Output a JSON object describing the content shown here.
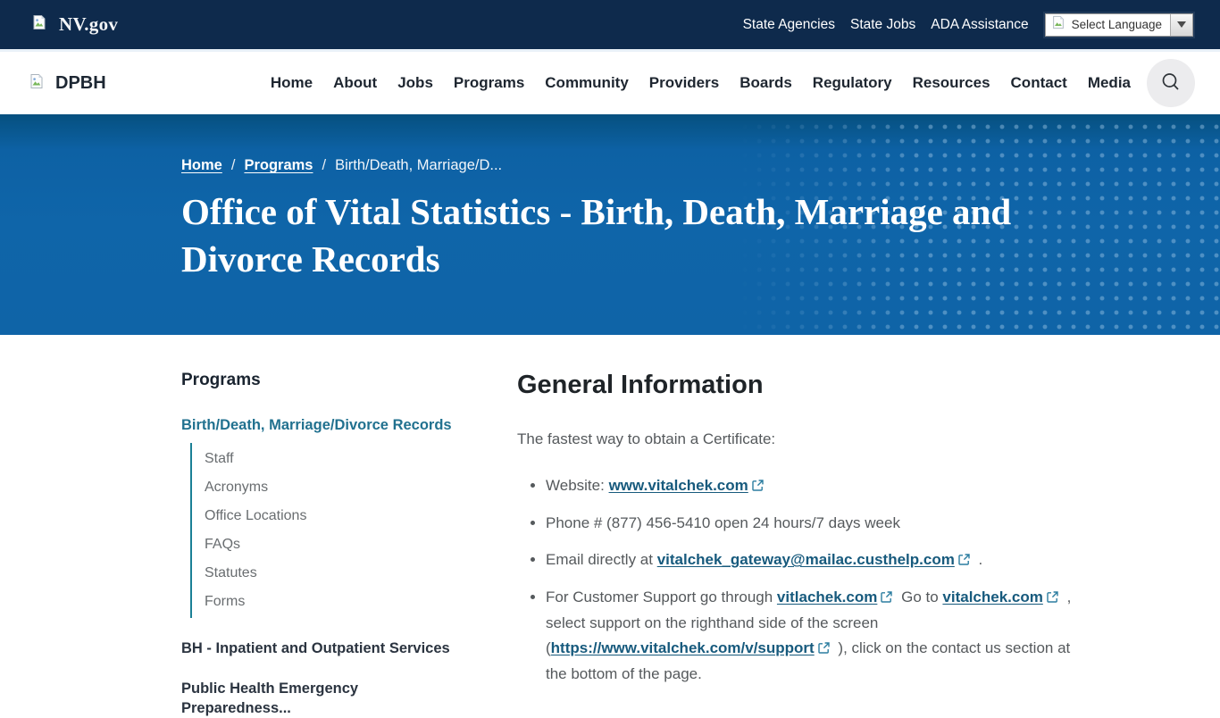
{
  "topbar": {
    "brand": "NV.gov",
    "links": [
      "State Agencies",
      "State Jobs",
      "ADA Assistance"
    ],
    "language_label": "Select Language"
  },
  "nav": {
    "brand": "DPBH",
    "items": [
      "Home",
      "About",
      "Jobs",
      "Programs",
      "Community",
      "Providers",
      "Boards",
      "Regulatory",
      "Resources",
      "Contact",
      "Media"
    ],
    "search_icon": "magnifier"
  },
  "hero": {
    "breadcrumb": [
      {
        "label": "Home",
        "link": true
      },
      {
        "label": "Programs",
        "link": true
      },
      {
        "label": "Birth/Death, Marriage/D...",
        "link": false
      }
    ],
    "title": "Office of Vital Statistics - Birth, Death, Marriage and Divorce Records"
  },
  "sidebar": {
    "heading": "Programs",
    "active_item": "Birth/Death, Marriage/Divorce Records",
    "sub_items": [
      "Staff",
      "Acronyms",
      "Office Locations",
      "FAQs",
      "Statutes",
      "Forms"
    ],
    "other_items": [
      "BH - Inpatient and Outpatient Services",
      "Public Health Emergency Preparedness..."
    ]
  },
  "main": {
    "heading": "General Information",
    "intro": "The fastest way to obtain a Certificate:",
    "bullets": [
      [
        {
          "t": "Website: "
        },
        {
          "l": "www.vitalchek.com",
          "ext": true
        }
      ],
      [
        {
          "t": "Phone # (877) 456-5410 open 24 hours/7 days week"
        }
      ],
      [
        {
          "t": "Email directly at "
        },
        {
          "l": "vitalchek_gateway@mailac.custhelp.com",
          "ext": true
        },
        {
          "t": " ."
        }
      ],
      [
        {
          "t": "For Customer Support go through "
        },
        {
          "l": "vitlachek.com",
          "ext": true
        },
        {
          "t": "  Go to "
        },
        {
          "l": "vitalchek.com",
          "ext": true
        },
        {
          "t": " , select support on the righthand side of the screen ("
        },
        {
          "l": "https://www.vitalchek.com/v/support",
          "ext": true
        },
        {
          "t": " ), click on the contact us section at the bottom of the page."
        }
      ]
    ]
  },
  "colors": {
    "topbar_bg": "#0e2a4c",
    "hero_bg": "#0f65a9",
    "accent_teal": "#1b8096",
    "active_link": "#21718f",
    "body_link": "#175a7d",
    "body_text": "#55595c",
    "external_icon": "#2b7da0"
  }
}
